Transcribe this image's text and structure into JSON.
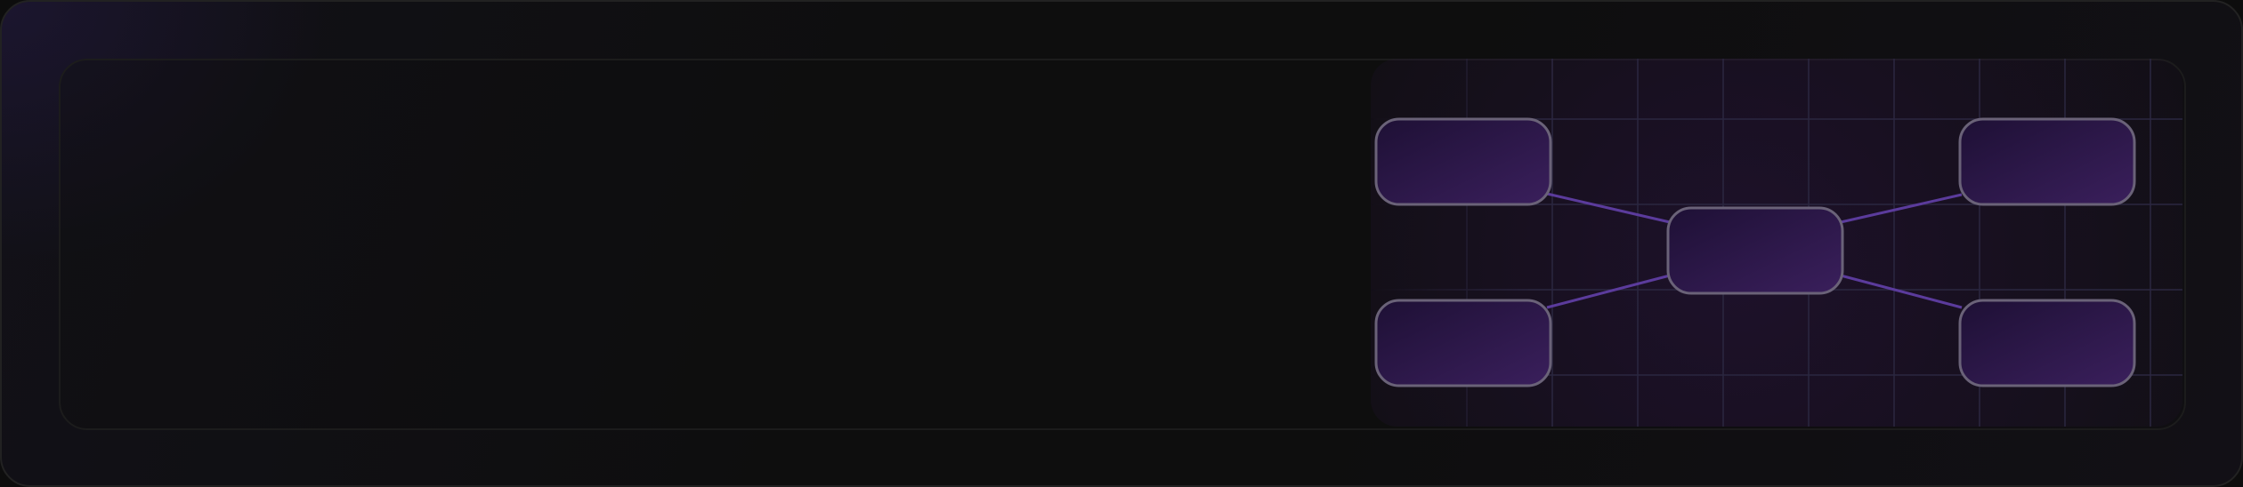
{
  "diagram": {
    "accent": "#5b3b9c",
    "node_fill_top": "#1e1035",
    "node_fill_bottom": "#3a1f5c",
    "node_border": "#6a6278",
    "grid_color": "#2b2740",
    "nodes": [
      {
        "id": "top-left",
        "label": ""
      },
      {
        "id": "center",
        "label": ""
      },
      {
        "id": "top-right",
        "label": ""
      },
      {
        "id": "bottom-left",
        "label": ""
      },
      {
        "id": "bottom-right",
        "label": ""
      }
    ],
    "edges": [
      {
        "from": "top-left",
        "to": "center"
      },
      {
        "from": "bottom-left",
        "to": "center"
      },
      {
        "from": "center",
        "to": "top-right"
      },
      {
        "from": "center",
        "to": "bottom-right"
      }
    ]
  }
}
